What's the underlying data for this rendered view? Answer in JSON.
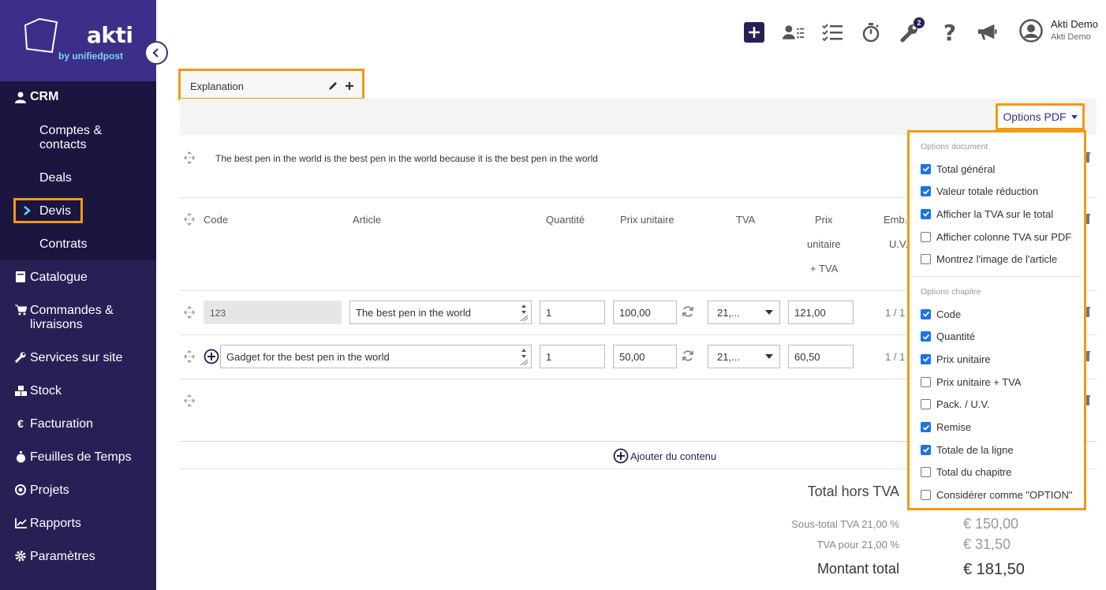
{
  "brand": {
    "name": "akti",
    "tagline": "by unifiedpost",
    "accent": "#f39a12",
    "sidebar_bg": "#2a1f55",
    "logo_bg": "#3b2f8a"
  },
  "sidebar": {
    "crm_label": "CRM",
    "crm_items": [
      {
        "label_line1": "Comptes &",
        "label_line2": "contacts"
      },
      {
        "label": "Deals"
      },
      {
        "label": "Devis",
        "active": true
      },
      {
        "label": "Contrats"
      }
    ],
    "items": [
      {
        "label": "Catalogue",
        "icon": "book-icon"
      },
      {
        "label_line1": "Commandes &",
        "label_line2": "livraisons",
        "icon": "cart-icon"
      },
      {
        "label": "Services sur site",
        "icon": "wrench-icon"
      },
      {
        "label": "Stock",
        "icon": "boxes-icon"
      },
      {
        "label": "Facturation",
        "icon": "euro-icon"
      },
      {
        "label": "Feuilles de Temps",
        "icon": "stopwatch-icon"
      },
      {
        "label": "Projets",
        "icon": "target-icon"
      },
      {
        "label": "Rapports",
        "icon": "chart-line-icon"
      },
      {
        "label": "Paramètres",
        "icon": "gear-icon"
      }
    ]
  },
  "topbar": {
    "notification_count": "2",
    "user_name": "Akti Demo",
    "user_company": "Akti Demo"
  },
  "content": {
    "explanation_label": "Explanation",
    "options_pdf_label": "Options PDF",
    "text_line": "The best pen in the world is the best pen in the world because it is the best pen in the world",
    "headers": {
      "code": "Code",
      "article": "Article",
      "quantity": "Quantité",
      "unit_price": "Prix unitaire",
      "vat": "TVA",
      "price_vat_1": "Prix",
      "price_vat_2": "unitaire",
      "price_vat_3": "+ TVA",
      "pack_1": "Emb.",
      "pack_2": "U.V."
    },
    "rows": [
      {
        "code": "123",
        "article": "The best pen in the world",
        "qty": "1",
        "unit_price": "100,00",
        "vat": "21,...",
        "price_vat": "121,00",
        "ratio": "1 / 1"
      },
      {
        "code": "",
        "article": "Gadget for the best pen in the world",
        "qty": "1",
        "unit_price": "50,00",
        "vat": "21,...",
        "price_vat": "60,50",
        "ratio": "1 / 1"
      }
    ],
    "add_content_label": "Ajouter du contenu",
    "totals": {
      "excl_vat_label": "Total hors TVA",
      "subtotal_label": "Sous-total  TVA 21,00 %",
      "subtotal_value": "€ 150,00",
      "vat_label": "TVA pour 21,00 %",
      "vat_value": "€ 31,50",
      "total_label": "Montant total",
      "total_value": "€ 181,50"
    }
  },
  "pdf_options": {
    "document_heading": "Options document",
    "document_options": [
      {
        "label": "Total général",
        "checked": true
      },
      {
        "label": "Valeur totale réduction",
        "checked": true
      },
      {
        "label": "Afficher la TVA sur le total",
        "checked": true
      },
      {
        "label": "Afficher colonne TVA sur PDF",
        "checked": false
      },
      {
        "label": "Montrez l'image de l'article",
        "checked": false
      }
    ],
    "chapter_heading": "Options chapitre",
    "chapter_options": [
      {
        "label": "Code",
        "checked": true
      },
      {
        "label": "Quantité",
        "checked": true
      },
      {
        "label": "Prix unitaire",
        "checked": true
      },
      {
        "label": "Prix unitaire + TVA",
        "checked": false
      },
      {
        "label": "Pack. / U.V.",
        "checked": false
      },
      {
        "label": "Remise",
        "checked": true
      },
      {
        "label": "Totale de la ligne",
        "checked": true
      },
      {
        "label": "Total du chapitre",
        "checked": false
      },
      {
        "label": "Considérer comme \"OPTION\"",
        "checked": false
      }
    ]
  }
}
